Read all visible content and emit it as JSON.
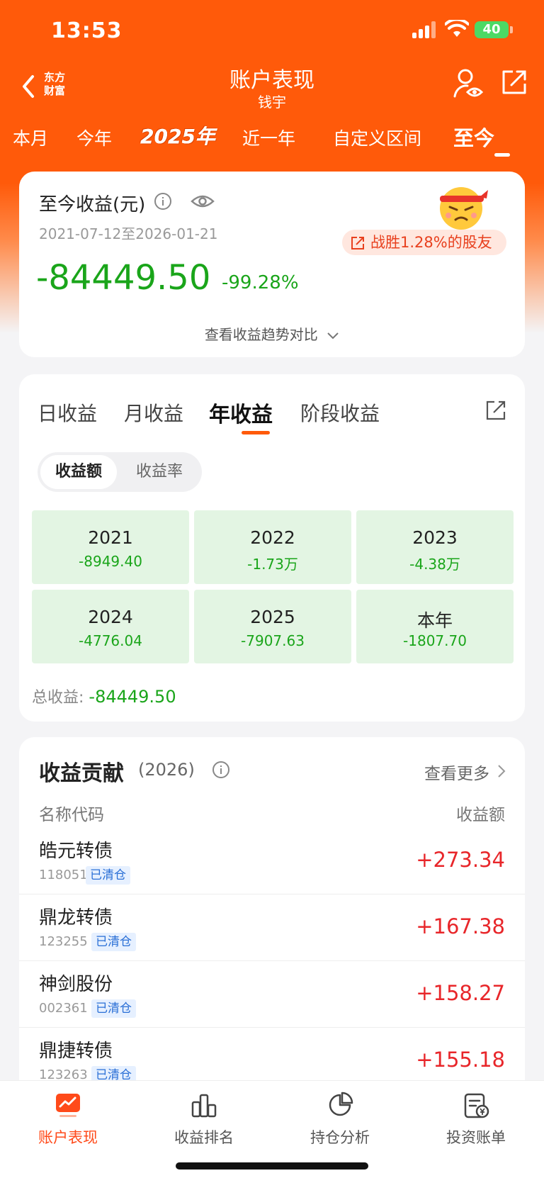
{
  "status_bar": {
    "time": "13:53",
    "battery": "40"
  },
  "header": {
    "brand_line1": "东方",
    "brand_line2": "财富",
    "title": "账户表现",
    "subtitle": "钱宇"
  },
  "period_tabs": [
    {
      "label": "本月"
    },
    {
      "label": "今年"
    },
    {
      "label": "2025年"
    },
    {
      "label": "近一年"
    },
    {
      "label": "自定义区间"
    },
    {
      "label": "至今",
      "active": true
    }
  ],
  "summary": {
    "title": "至今收益(元)",
    "date_range": "2021-07-12至2026-01-21",
    "amount": "-84449.50",
    "percent": "-99.28%",
    "beat_text": "战胜1.28%的股友",
    "trend_link": "查看收益趋势对比"
  },
  "profit_tabs": [
    {
      "label": "日收益"
    },
    {
      "label": "月收益"
    },
    {
      "label": "年收益",
      "active": true
    },
    {
      "label": "阶段收益"
    }
  ],
  "segment": {
    "options": [
      "收益额",
      "收益率"
    ],
    "selected": "收益额"
  },
  "yearly": [
    {
      "year": "2021",
      "value": "-8949.40"
    },
    {
      "year": "2022",
      "value": "-1.73万"
    },
    {
      "year": "2023",
      "value": "-4.38万"
    },
    {
      "year": "2024",
      "value": "-4776.04"
    },
    {
      "year": "2025",
      "value": "-7907.63"
    },
    {
      "year": "本年",
      "value": "-1807.70"
    }
  ],
  "total": {
    "label": "总收益:",
    "value": "-84449.50"
  },
  "contribution": {
    "title": "收益贡献",
    "year": "(2026)",
    "more": "查看更多",
    "col_name": "名称代码",
    "col_value": "收益额",
    "rows": [
      {
        "name": "皓元转债",
        "code": "118051",
        "tag": "已清仓",
        "value": "+273.34"
      },
      {
        "name": "鼎龙转债",
        "code": "123255",
        "tag": "已清仓",
        "value": "+167.38"
      },
      {
        "name": "神剑股份",
        "code": "002361",
        "tag": "已清仓",
        "value": "+158.27"
      },
      {
        "name": "鼎捷转债",
        "code": "123263",
        "tag": "已清仓",
        "value": "+155.18"
      }
    ]
  },
  "bottom_nav": [
    {
      "label": "账户表现",
      "icon": "chart-screen-icon",
      "active": true
    },
    {
      "label": "收益排名",
      "icon": "bar-ranking-icon"
    },
    {
      "label": "持仓分析",
      "icon": "pie-chart-icon"
    },
    {
      "label": "投资账单",
      "icon": "bill-icon"
    }
  ],
  "colors": {
    "brand": "#ff5a0a",
    "loss": "#1aa51a",
    "gain": "#e8262a",
    "grid_bg": "#e3f5e3"
  }
}
